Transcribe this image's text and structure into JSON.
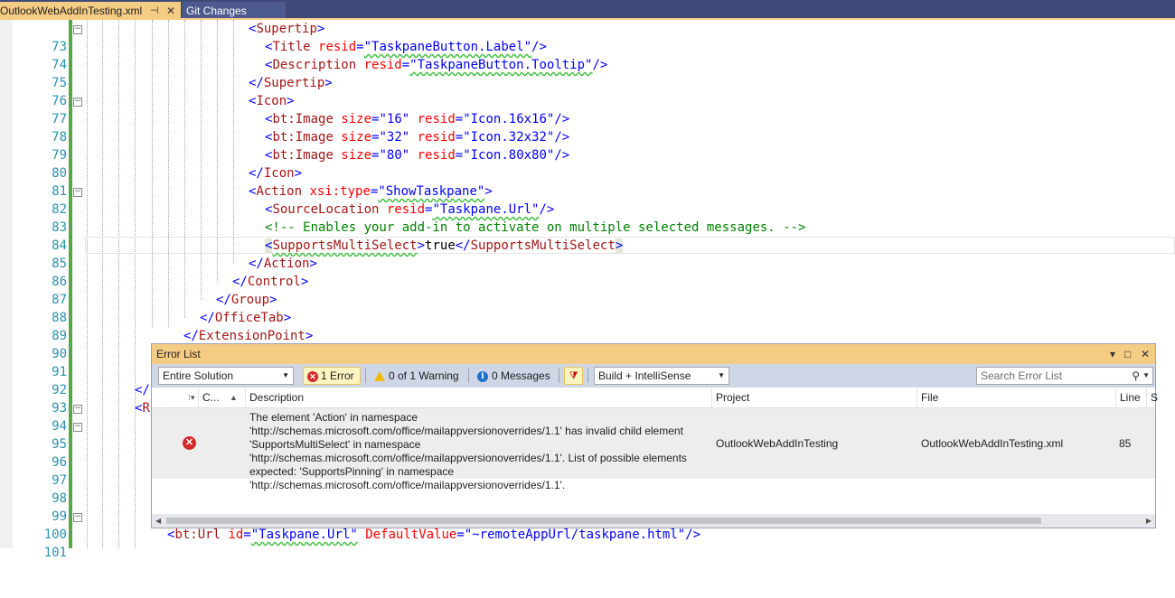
{
  "tabs": {
    "active": "OutlookWebAddInTesting.xml",
    "inactive": "Git Changes"
  },
  "editor": {
    "line_numbers": [
      "73",
      "74",
      "75",
      "76",
      "77",
      "78",
      "79",
      "80",
      "81",
      "82",
      "83",
      "84",
      "85",
      "86",
      "87",
      "88",
      "89",
      "90",
      "91",
      "92",
      "93",
      "94",
      "95",
      "96",
      "97",
      "98",
      "99",
      "100",
      "101"
    ],
    "lines": {
      "l73": {
        "open": "<",
        "tag": "Supertip",
        "close": ">"
      },
      "l74": {
        "open": "<",
        "tag": "Title",
        "attr": " resid",
        "eq": "=",
        "val": "\"TaskpaneButton.Label\"",
        "close": "/>"
      },
      "l75": {
        "open": "<",
        "tag": "Description",
        "attr": " resid",
        "eq": "=",
        "val": "\"TaskpaneButton.Tooltip\"",
        "close": "/>"
      },
      "l76": {
        "open": "</",
        "tag": "Supertip",
        "close": ">"
      },
      "l77": {
        "open": "<",
        "tag": "Icon",
        "close": ">"
      },
      "l78": {
        "open": "<",
        "tag": "bt:Image",
        "attr1": " size",
        "eq": "=",
        "val1": "\"16\"",
        "attr2": " resid",
        "val2": "\"Icon.16x16\"",
        "close": "/>"
      },
      "l79": {
        "open": "<",
        "tag": "bt:Image",
        "attr1": " size",
        "eq": "=",
        "val1": "\"32\"",
        "attr2": " resid",
        "val2": "\"Icon.32x32\"",
        "close": "/>"
      },
      "l80": {
        "open": "<",
        "tag": "bt:Image",
        "attr1": " size",
        "eq": "=",
        "val1": "\"80\"",
        "attr2": " resid",
        "val2": "\"Icon.80x80\"",
        "close": "/>"
      },
      "l81": {
        "open": "</",
        "tag": "Icon",
        "close": ">"
      },
      "l82": {
        "open": "<",
        "tag": "Action",
        "attr": " xsi:type",
        "eq": "=",
        "val": "\"ShowTaskpane\"",
        "close": ">"
      },
      "l83": {
        "open": "<",
        "tag": "SourceLocation",
        "attr": " resid",
        "eq": "=",
        "val": "\"Taskpane.Url\"",
        "close": "/>"
      },
      "l84": {
        "comment": "<!-- Enables your add-in to activate on multiple selected messages. -->"
      },
      "l85": {
        "open": "<",
        "tag": "SupportsMultiSelect",
        "close": ">",
        "text": "true",
        "open2": "</",
        "tag2": "SupportsMultiSelect",
        "close2": ">"
      },
      "l86": {
        "open": "</",
        "tag": "Action",
        "close": ">"
      },
      "l87": {
        "open": "</",
        "tag": "Control",
        "close": ">"
      },
      "l88": {
        "open": "</",
        "tag": "Group",
        "close": ">"
      },
      "l89": {
        "open": "</",
        "tag": "OfficeTab",
        "close": ">"
      },
      "l90": {
        "open": "</",
        "tag": "ExtensionPoint",
        "close": ">"
      },
      "l93": {
        "open": "</"
      },
      "l94": {
        "open": "<",
        "tag": "R"
      },
      "l101": {
        "open": "<",
        "tag": "bt:Url",
        "attr1": " id",
        "eq": "=",
        "val1": "\"Taskpane.Url\"",
        "attr2": " DefaultValue",
        "val2": "\"~remoteAppUrl/taskpane.html\"",
        "close": "/>"
      }
    }
  },
  "error_list": {
    "title": "Error List",
    "title_controls": {
      "dropdown": "▾",
      "maximize": "□",
      "close": "✕"
    },
    "scope": "Entire Solution",
    "errors_btn": "1 Error",
    "warnings_btn": "0 of 1 Warning",
    "messages_btn": "0 Messages",
    "build_filter": "Build + IntelliSense",
    "search_placeholder": "Search Error List",
    "columns": {
      "code": "C...",
      "description": "Description",
      "project": "Project",
      "file": "File",
      "line": "Line",
      "extra": "S"
    },
    "row": {
      "description": "The element 'Action' in namespace 'http://schemas.microsoft.com/office/mailappversionoverrides/1.1' has invalid child element 'SupportsMultiSelect' in namespace 'http://schemas.microsoft.com/office/mailappversionoverrides/1.1'. List of possible elements expected: 'SupportsPinning' in namespace 'http://schemas.microsoft.com/office/mailappversionoverrides/1.1'.",
      "project": "OutlookWebAddInTesting",
      "file": "OutlookWebAddInTesting.xml",
      "line": "85"
    }
  },
  "colors": {
    "tag": "#a31515",
    "bracket": "#0000ff",
    "attribute": "#ff0000",
    "value": "#0000ff",
    "comment": "#008000",
    "line_number": "#2b91af",
    "tab_active": "#f5cc84",
    "tab_bar": "#3f4a78"
  }
}
